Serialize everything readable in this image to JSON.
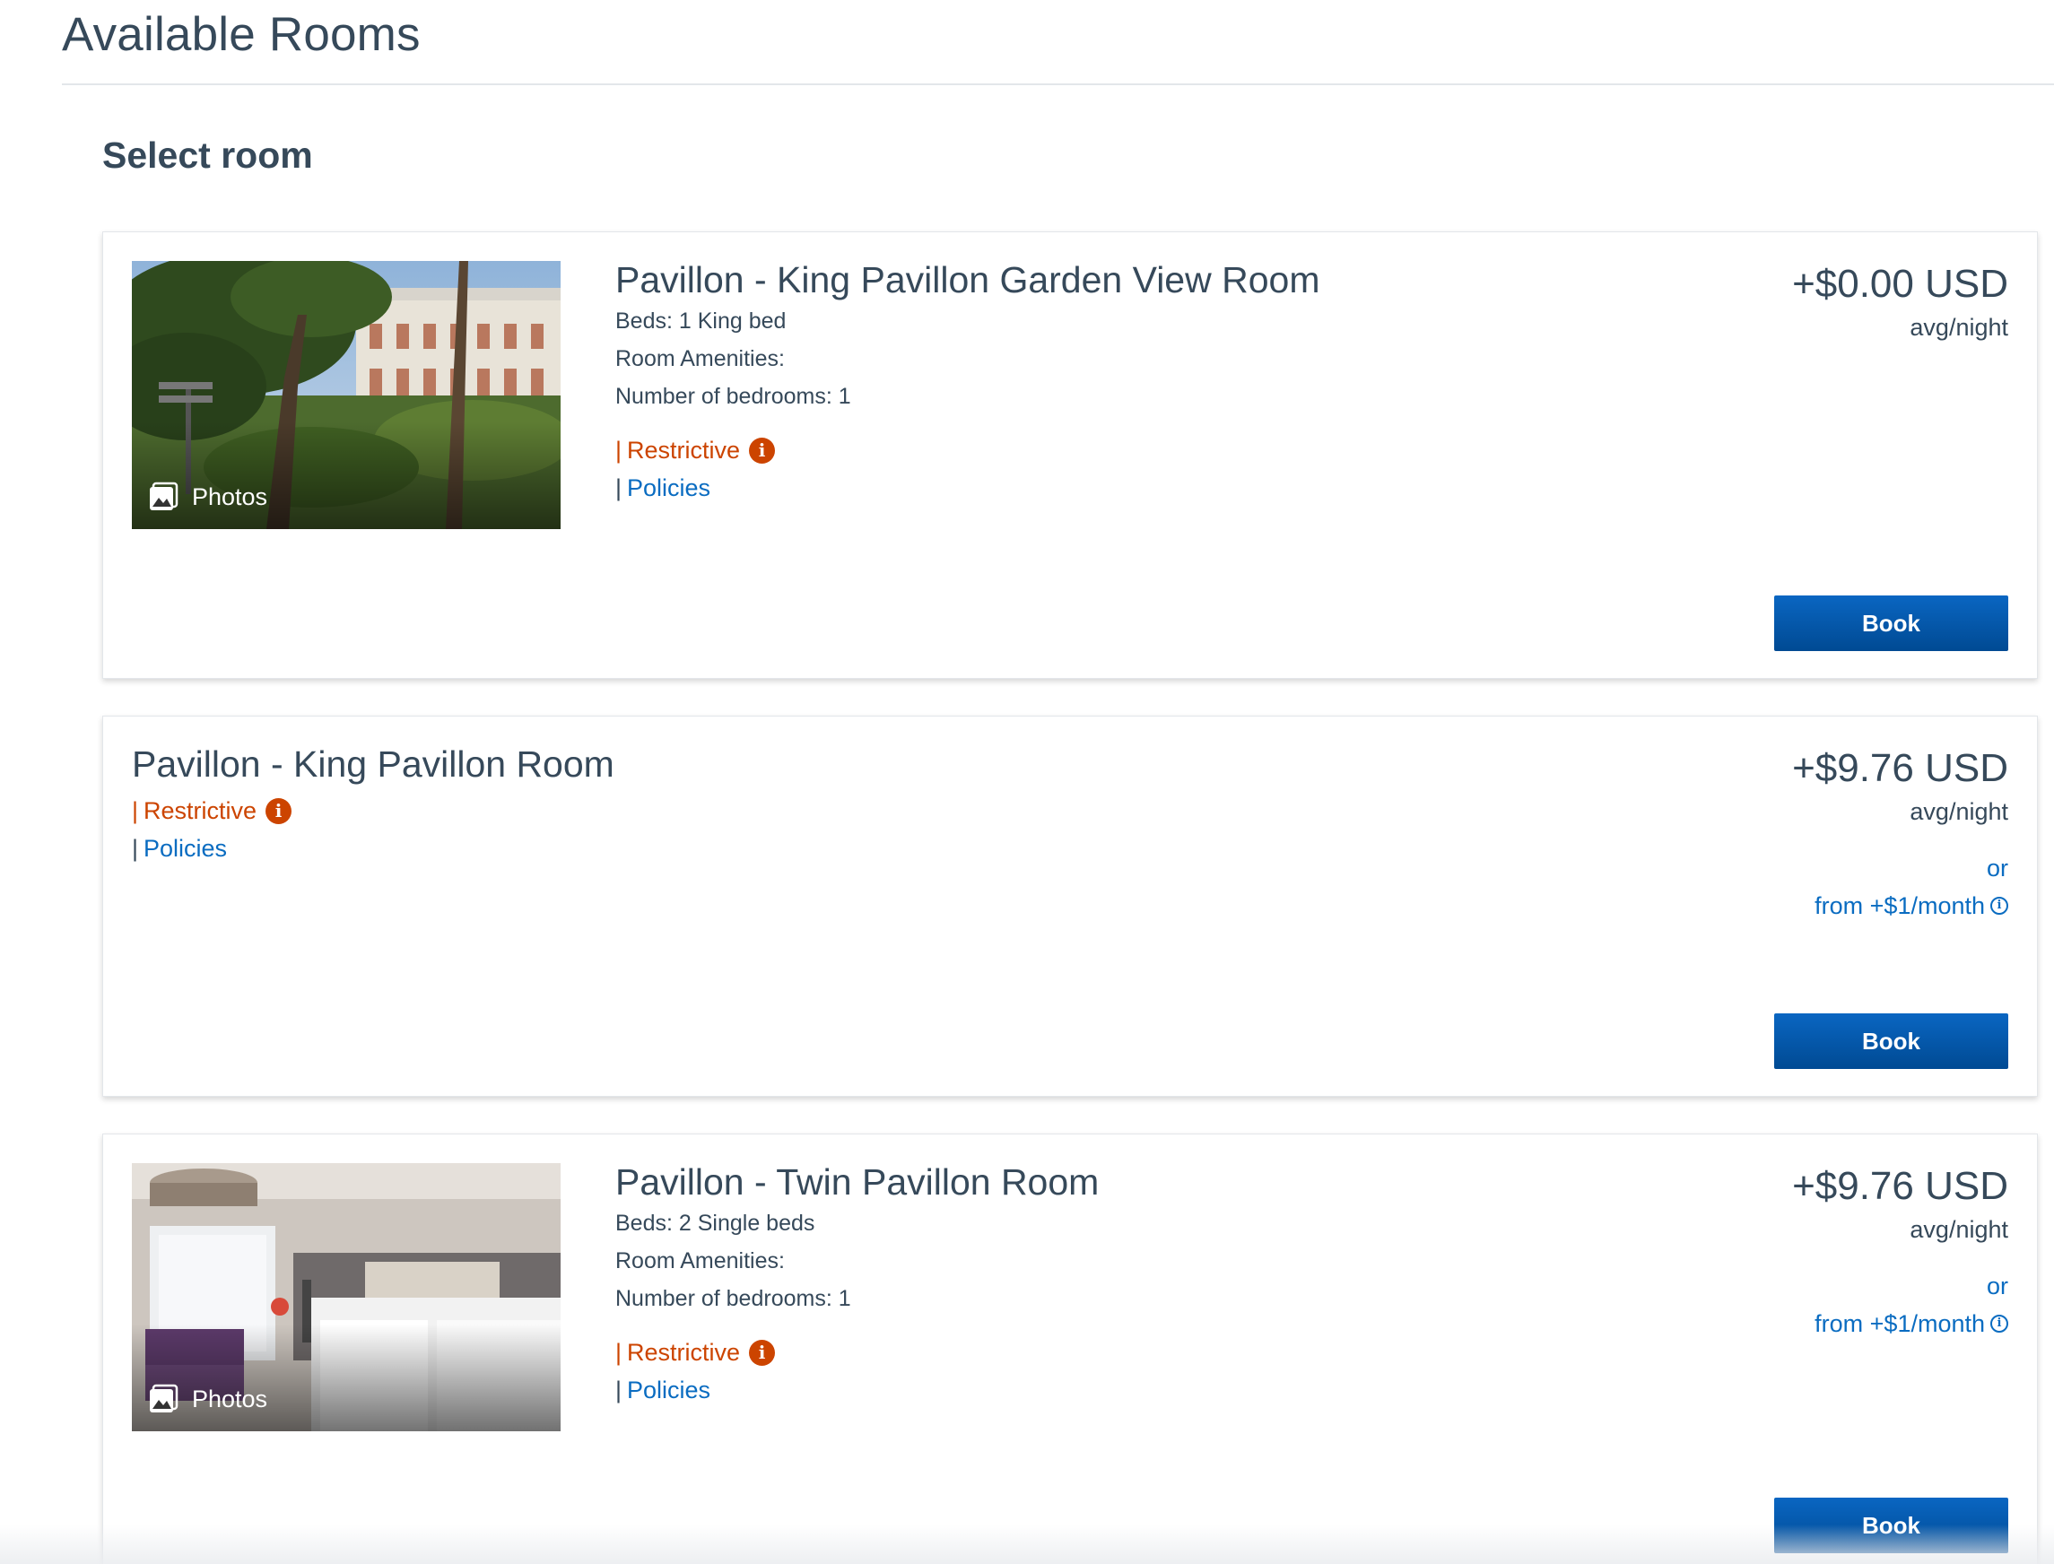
{
  "header": {
    "title": "Available Rooms"
  },
  "section": {
    "title": "Select room"
  },
  "rooms": [
    {
      "name": "Pavillon - King Pavillon Garden View Room",
      "photos_label": "Photos",
      "beds": "Beds: 1 King bed",
      "amenities": "Room Amenities:",
      "bedrooms": "Number of bedrooms: 1",
      "pipe": "|",
      "restrictive": "Restrictive",
      "policies": "Policies",
      "price": "+$0.00 USD",
      "per_night": "avg/night",
      "book": "Book"
    },
    {
      "name": "Pavillon - King Pavillon Room",
      "pipe": "|",
      "restrictive": "Restrictive",
      "policies": "Policies",
      "price": "+$9.76 USD",
      "per_night": "avg/night",
      "or": "or",
      "monthly": "from +$1/month",
      "book": "Book"
    },
    {
      "name": "Pavillon - Twin Pavillon Room",
      "photos_label": "Photos",
      "beds": "Beds: 2 Single beds",
      "amenities": "Room Amenities:",
      "bedrooms": "Number of bedrooms: 1",
      "pipe": "|",
      "restrictive": "Restrictive",
      "policies": "Policies",
      "price": "+$9.76 USD",
      "per_night": "avg/night",
      "or": "or",
      "monthly": "from +$1/month",
      "book": "Book"
    }
  ],
  "icons": {
    "photos": "photo-gallery-icon",
    "restrictive_info": "info-icon",
    "monthly_info": "info-circle-icon"
  },
  "colors": {
    "text": "#36495a",
    "restrictive": "#cc4400",
    "link": "#0a6cc1",
    "button": "#004a93"
  }
}
